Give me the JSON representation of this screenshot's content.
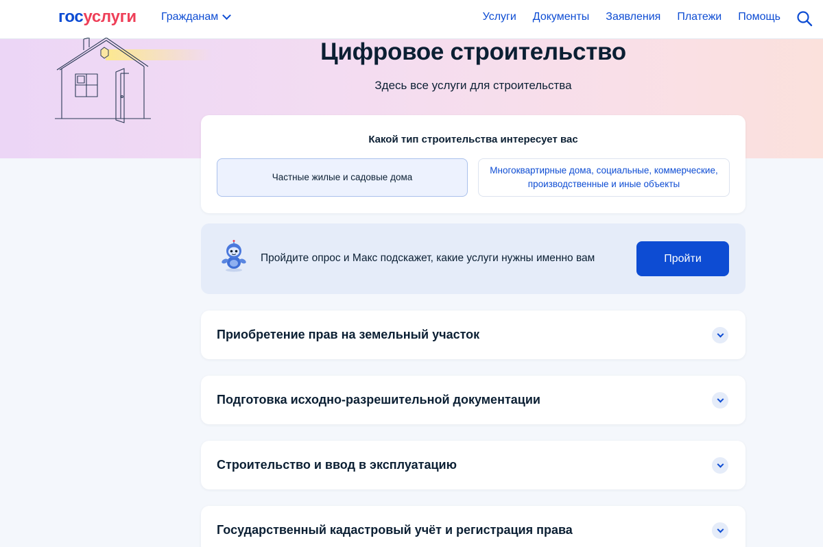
{
  "header": {
    "logo_part1": "гос",
    "logo_part2": "услуги",
    "audience": "Гражданам",
    "nav": [
      "Услуги",
      "Документы",
      "Заявления",
      "Платежи",
      "Помощь"
    ]
  },
  "hero": {
    "title": "Цифровое строительство",
    "subtitle": "Здесь все услуги для строительства"
  },
  "construction_type": {
    "question": "Какой тип строительства интересует вас",
    "options": [
      {
        "label": "Частные жилые и садовые дома",
        "selected": true
      },
      {
        "label": "Многоквартирные дома, социальные, коммерческие, производственные и иные объекты",
        "selected": false
      }
    ]
  },
  "quiz": {
    "text": "Пройдите опрос и Макс подскажет, какие услуги нужны именно вам",
    "button": "Пройти"
  },
  "sections": [
    {
      "label": "Приобретение прав на земельный участок"
    },
    {
      "label": "Подготовка исходно-разрешительной документации"
    },
    {
      "label": "Строительство и ввод в эксплуатацию"
    },
    {
      "label": "Государственный кадастровый учёт и регистрация права"
    }
  ],
  "icons": {
    "search": "search-icon",
    "chevron": "chevron-down-icon",
    "illustration": "house-illustration",
    "assistant": "robot-assistant-icon"
  },
  "colors": {
    "brand_blue": "#0d4cd3",
    "brand_red": "#ee3f58",
    "text": "#0b1f33",
    "page_bg": "#f4f7fc"
  }
}
